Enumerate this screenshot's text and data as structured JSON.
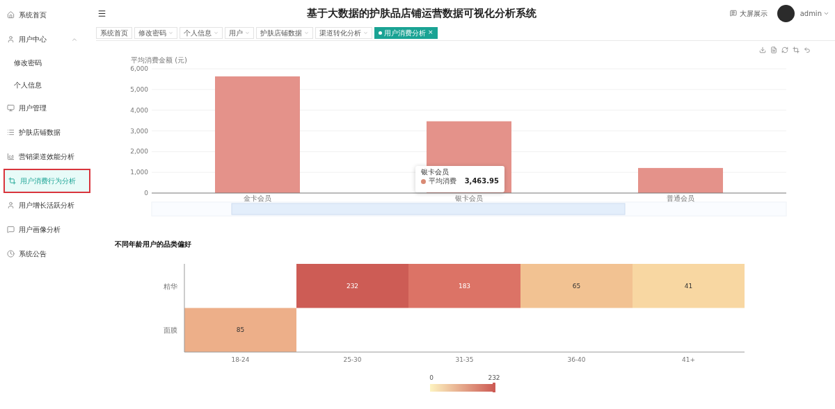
{
  "sidebar": {
    "items": [
      {
        "label": "系统首页",
        "selected": false
      },
      {
        "label": "用户中心",
        "selected": false,
        "expanded": true,
        "children": [
          {
            "label": "修改密码",
            "selected": false
          },
          {
            "label": "个人信息",
            "selected": false
          }
        ]
      },
      {
        "label": "用户管理",
        "selected": false
      },
      {
        "label": "护肤店铺数据",
        "selected": false
      },
      {
        "label": "营销渠道效能分析",
        "selected": false
      },
      {
        "label": "用户消费行为分析",
        "selected": true
      },
      {
        "label": "用户增长活跃分析",
        "selected": false
      },
      {
        "label": "用户画像分析",
        "selected": false
      },
      {
        "label": "系统公告",
        "selected": false
      }
    ]
  },
  "header": {
    "title": "基于大数据的护肤品店铺运营数据可视化分析系统",
    "screen_link": "大屏展示",
    "user": "admin"
  },
  "tabs": [
    {
      "label": "系统首页",
      "has_menu": false,
      "selected": false
    },
    {
      "label": "修改密码",
      "has_menu": true,
      "selected": false
    },
    {
      "label": "个人信息",
      "has_menu": true,
      "selected": false
    },
    {
      "label": "用户",
      "has_menu": true,
      "selected": false
    },
    {
      "label": "护肤店铺数据",
      "has_menu": true,
      "selected": false
    },
    {
      "label": "渠道转化分析",
      "has_menu": true,
      "selected": false
    },
    {
      "label": "用户消费分析",
      "has_menu": false,
      "selected": true,
      "close": "×"
    }
  ],
  "bar_chart": {
    "chart_data": {
      "type": "bar",
      "ylabel": "平均消费金额 (元)",
      "categories": [
        "金卡会员",
        "银卡会员",
        "普通会员"
      ],
      "series": [
        {
          "name": "平均消费",
          "color": "#e4928a",
          "values": [
            5630,
            3464,
            1210
          ]
        }
      ],
      "grid": true,
      "ylim": [
        0,
        6000
      ],
      "yticks": [
        0,
        {
          "value": 1000,
          "label": "1,000"
        },
        {
          "value": 2000,
          "label": "2,000"
        },
        {
          "value": 3000,
          "label": "3,000"
        },
        {
          "value": 4000,
          "label": "4,000"
        },
        {
          "value": 5000,
          "label": "5,000"
        },
        {
          "value": 6000,
          "label": "6,000"
        }
      ]
    },
    "tooltip": {
      "title": "银卡会员",
      "value": "3,463.95",
      "color": "#d98a74"
    }
  },
  "heatmap": {
    "title": "不同年龄用户的品类偏好",
    "x_categories": [
      "18-24",
      "25-30",
      "31-35",
      "36-40",
      "41+"
    ],
    "rows": [
      {
        "label": "精华",
        "cells": [
          null,
          {
            "value": "232",
            "color": "#cd5c55"
          },
          {
            "value": "183",
            "color": "#dc7366"
          },
          {
            "value": "65",
            "color": "#f2c292"
          },
          {
            "value": "41",
            "color": "#f8d7a2"
          }
        ]
      },
      {
        "label": "面膜",
        "cells": [
          {
            "value": "85",
            "color": "#edaf89"
          },
          null,
          null,
          null,
          null
        ]
      }
    ],
    "scale": {
      "min": "0",
      "max": "232"
    }
  }
}
